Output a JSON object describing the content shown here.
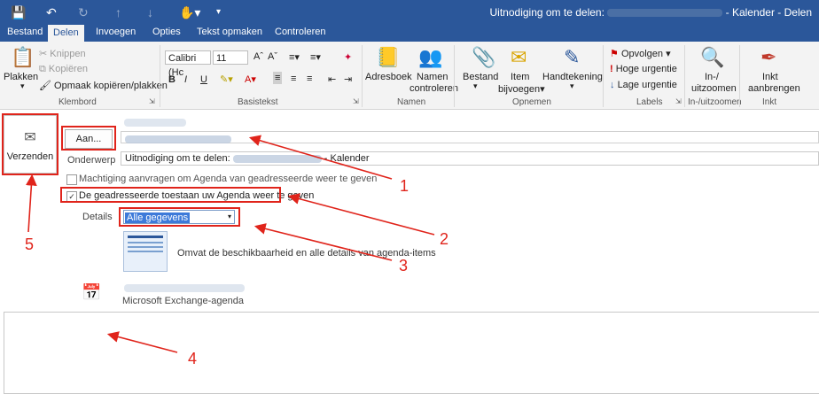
{
  "window": {
    "title_prefix": "Uitnodiging om te delen:",
    "title_suffix": "- Kalender - Delen"
  },
  "qat_icons": [
    "save-icon",
    "undo-icon",
    "redo-icon",
    "up-icon",
    "down-icon",
    "touch-mode-icon",
    "customize-icon"
  ],
  "tabs": [
    "Bestand",
    "Delen",
    "Invoegen",
    "Opties",
    "Tekst opmaken",
    "Controleren"
  ],
  "ribbon": {
    "klembord": {
      "plakken": "Plakken",
      "knippen": "Knippen",
      "kopieren": "Kopiëren",
      "opmaak": "Opmaak kopiëren/plakken",
      "label": "Klembord"
    },
    "basistekst": {
      "font": "Calibri (Hc",
      "size": "11",
      "label": "Basistekst"
    },
    "namen": {
      "adresboek": "Adresboek",
      "namen1": "Namen",
      "namen2": "controleren",
      "label": "Namen"
    },
    "opnemen": {
      "bestand": "Bestand",
      "item1": "Item",
      "item2": "bijvoegen",
      "handtekening": "Handtekening",
      "label": "Opnemen"
    },
    "labels": {
      "opvolgen": "Opvolgen",
      "hoge": "Hoge urgentie",
      "lage": "Lage urgentie",
      "label": "Labels"
    },
    "zoom": {
      "l1": "In-/",
      "l2": "uitzoomen",
      "label": "In-/uitzoomen"
    },
    "inkt": {
      "l1": "Inkt",
      "l2": "aanbrengen",
      "label": "Inkt"
    }
  },
  "form": {
    "verzenden": "Verzenden",
    "aan": "Aan...",
    "onderwerp_label": "Onderwerp",
    "onderwerp_prefix": "Uitnodiging om te delen:",
    "onderwerp_suffix": "- Kalender",
    "machtiging": "Machtiging aanvragen om Agenda van geadresseerde weer te geven",
    "toestaan": "De geadresseerde toestaan uw Agenda weer te geven",
    "toestaan_checked": true,
    "details_label": "Details",
    "details_value": "Alle gegevens",
    "omvat": "Omvat de beschikbaarheid en alle details van agenda-items",
    "exchange": "Microsoft Exchange-agenda"
  },
  "annotations": [
    "1",
    "2",
    "3",
    "4",
    "5"
  ],
  "colors": {
    "accent": "#2b579a",
    "annotation": "#e0241b"
  }
}
